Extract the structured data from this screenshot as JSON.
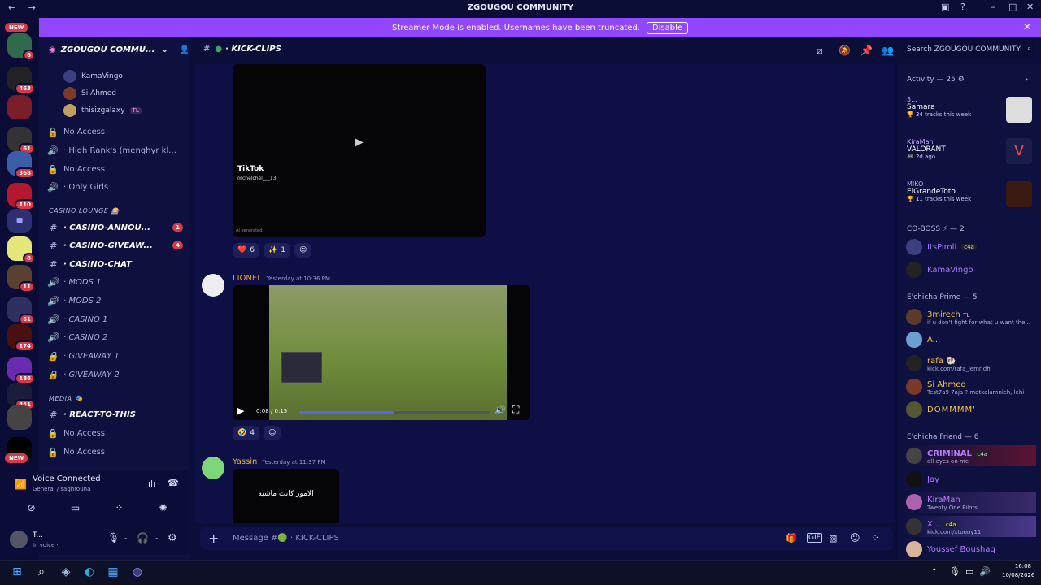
{
  "titlebar": {
    "title": "ZGOUGOU COMMUNITY",
    "nav": "← →"
  },
  "banner": {
    "text": "Streamer Mode is enabled. Usernames have been truncated.",
    "button": "Disable"
  },
  "rail": {
    "new_top": "NEW",
    "new_bottom": "NEW",
    "servers": [
      {
        "badge": "6"
      },
      {
        "badge": "463"
      },
      {
        "badge": ""
      },
      {
        "badge": "61"
      },
      {
        "badge": "368"
      },
      {
        "badge": "110"
      },
      {
        "badge": ""
      },
      {
        "badge": "8"
      },
      {
        "badge": "11"
      },
      {
        "badge": "61"
      },
      {
        "badge": "174"
      },
      {
        "badge": "186"
      },
      {
        "badge": "441"
      },
      {
        "badge": ""
      },
      {
        "badge": ""
      }
    ]
  },
  "server": {
    "name": "ZGOUGOU COMMU..."
  },
  "voice_members": [
    {
      "name": "KamaVingo"
    },
    {
      "name": "Si Ahmed"
    },
    {
      "name": "thisizgalaxy",
      "tag": "TL"
    }
  ],
  "channels_top": [
    {
      "icon": "🔒",
      "name": "No Access"
    },
    {
      "icon": "🔊",
      "name": "· High Rank's (menghyr kl..."
    },
    {
      "icon": "🔒",
      "name": "No Access"
    },
    {
      "icon": "🔊",
      "name": "· Only Girls"
    }
  ],
  "cat_casino": "CASINO LOUNGE 🎰",
  "casino_channels": [
    {
      "name": "· CASINO-ANNOU...",
      "badge": "1"
    },
    {
      "name": "· CASINO-GIVEAW...",
      "badge": "4"
    },
    {
      "name": "· CASINO-CHAT",
      "badge": ""
    },
    {
      "name": "· MODS 1",
      "badge": ""
    },
    {
      "name": "· MODS 2",
      "badge": ""
    },
    {
      "name": "· CASINO 1",
      "badge": ""
    },
    {
      "name": "· CASINO 2",
      "badge": ""
    },
    {
      "name": "· GIVEAWAY 1",
      "badge": ""
    },
    {
      "name": "· GIVEAWAY 2",
      "badge": ""
    }
  ],
  "cat_media": "MEDIA 🎭",
  "media_channels": [
    {
      "name": "· REACT-TO-THIS"
    },
    {
      "name": "No Access"
    },
    {
      "name": "No Access"
    }
  ],
  "voice": {
    "status": "Voice Connected",
    "sub": "General / saghrouna"
  },
  "user": {
    "name": "T...",
    "status": "In voice ·"
  },
  "channel": {
    "name": "· KICK-CLIPS"
  },
  "search": {
    "placeholder": "Search ZGOUGOU COMMUNITY"
  },
  "messages": {
    "tiktok": {
      "brand": "TikTok",
      "handle": "@chelchel___13",
      "note": "AI generated",
      "reactions": [
        {
          "emoji": "❤️",
          "count": "6"
        },
        {
          "emoji": "✨",
          "count": "1"
        }
      ]
    },
    "lionel": {
      "author": "LIONEL",
      "time": "Yesterday at 10:36 PM",
      "video_time": "0:08 / 0:15",
      "progress": 0.5,
      "reactions": [
        {
          "emoji": "🤣",
          "count": "4"
        }
      ]
    },
    "yassin": {
      "author": "Yassin",
      "time": "Yesterday at 11:37 PM",
      "text": "الامور كانت ماشية"
    }
  },
  "composer": {
    "placeholder": "Message #🟢 · KICK-CLIPS"
  },
  "members": {
    "activity_header": "Activity — 25",
    "activities": [
      {
        "user": "3...",
        "title": "Samara",
        "sub": "34 tracks this week"
      },
      {
        "user": "KiraMan",
        "title": "VALORANT",
        "sub": "2d ago"
      },
      {
        "user": "MIKO",
        "title": "ElGrandeToto",
        "sub": "11 tracks this week"
      }
    ],
    "coboss_header": "CO-BOSS ⚡ — 2",
    "coboss": [
      {
        "name": "ItsPiroli",
        "tag": "c4a",
        "sub": ""
      },
      {
        "name": "KamaVingo",
        "tag": "",
        "sub": ""
      }
    ],
    "prime_header": "E'chicha Prime — 5",
    "prime": [
      {
        "name": "3mirech",
        "tag": "TL",
        "sub": "if u don't fight for what u want the..."
      },
      {
        "name": "A...",
        "tag": "",
        "sub": ""
      },
      {
        "name": "rafa 🐏",
        "tag": "",
        "sub": "kick.com/rafa_lemridh"
      },
      {
        "name": "Si Ahmed",
        "tag": "",
        "sub": "Test7a9 7aja ? matkalamnich, lehi"
      },
      {
        "name": "DOMMMM'",
        "tag": "",
        "sub": ""
      }
    ],
    "friend_header": "E'chicha Friend — 6",
    "friends": [
      {
        "name": "CRIMINAL",
        "tag": "c4a",
        "sub": "all eyes on me"
      },
      {
        "name": "Jay",
        "tag": "",
        "sub": ""
      },
      {
        "name": "KiraMan",
        "tag": "",
        "sub": "Twenty One Pilots"
      },
      {
        "name": "X...",
        "tag": "c4a",
        "sub": "kick.com/xtoony11"
      },
      {
        "name": "Youssef Boushaq",
        "tag": "",
        "sub": ""
      }
    ]
  },
  "clock": {
    "time": "16:08",
    "date": "10/08/2026"
  },
  "colors": {
    "accent": "#9146ff",
    "badge": "#d63a4a",
    "online": "#3ba55d"
  }
}
